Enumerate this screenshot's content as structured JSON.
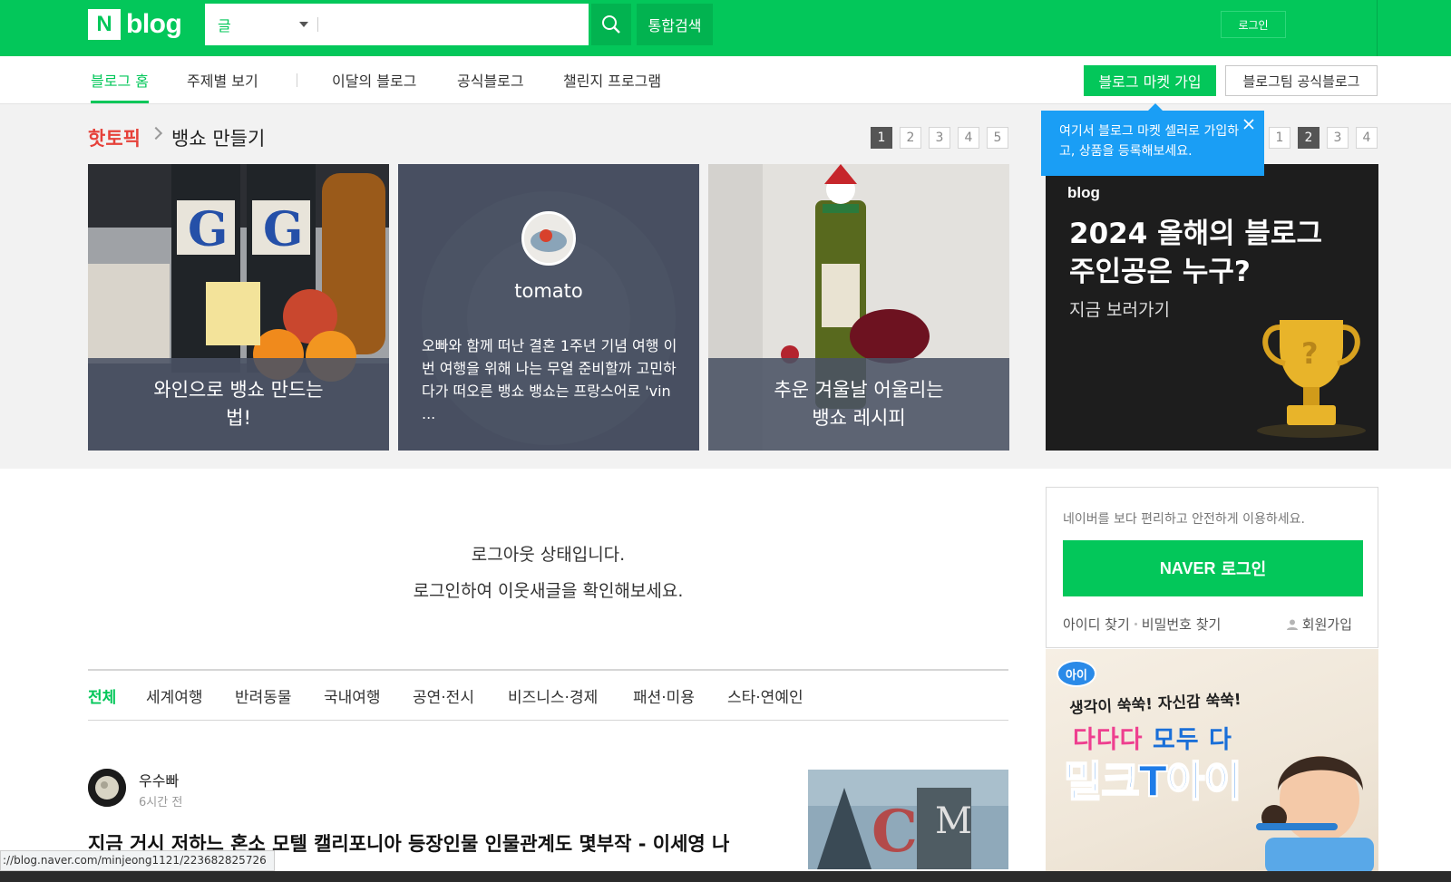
{
  "header": {
    "logo_n": "N",
    "logo_blog": "blog",
    "search_scope": "글",
    "search_placeholder": "",
    "unified_search": "통합검색",
    "login": "로그인"
  },
  "subnav": {
    "items": [
      "블로그 홈",
      "주제별 보기",
      "이달의 블로그",
      "공식블로그",
      "챌린지 프로그램"
    ],
    "market_join": "블로그 마켓 가입",
    "official_team": "블로그팀 공식블로그"
  },
  "hot": {
    "label": "핫토픽",
    "topic": "뱅쇼 만들기",
    "pages": [
      "1",
      "2",
      "3",
      "4",
      "5"
    ],
    "active_page": "1",
    "cards": [
      {
        "caption": "와인으로 뱅쇼 만드는 법!"
      },
      {
        "author": "tomato",
        "excerpt": "오빠와 함께 떠난 결혼 1주년 기념 여행 이번 여행을 위해 나는 무얼 준비할까 고민하다가 떠오른 뱅쇼 뱅쇼는 프랑스어로 'vin ..."
      },
      {
        "caption": "추운 겨울날 어울리는 뱅쇼 레시피"
      }
    ]
  },
  "promo": {
    "pages": [
      "1",
      "2",
      "3",
      "4"
    ],
    "active_page": "2",
    "logo": "blog",
    "title": "2024 올해의 블로그 주인공은 누구?",
    "sub": "지금 보러가기",
    "tooltip": "여기서 블로그 마켓 셀러로 가입하고, 상품을 등록해보세요."
  },
  "main": {
    "logout_line1": "로그아웃 상태입니다.",
    "logout_line2": "로그인하여 이웃새글을 확인해보세요.",
    "categories": [
      "전체",
      "세계여행",
      "반려동물",
      "국내여행",
      "공연·전시",
      "비즈니스·경제",
      "패션·미용",
      "스타·연예인"
    ],
    "post": {
      "author": "우수빠",
      "time": "6시간 전",
      "title": "지금 거시 저하느 혼소 모텔 캘리포니아 등장인물 인물관계도 몇부작 - 이세영 나"
    }
  },
  "login_box": {
    "desc": "네이버를 보다 편리하고 안전하게 이용하세요.",
    "button_brand": "NAVER",
    "button_label": "로그인",
    "find_id": "아이디 찾기",
    "find_pw": "비밀번호 찾기",
    "signup": "회원가입"
  },
  "ad": {
    "badge": "아이",
    "line1": "생각이 쑥쑥! 자신감 쑥쑥!",
    "line2a": "다다다",
    "line2b": "모두 다",
    "line3": "밀크T아이"
  },
  "status": {
    "url": "://blog.naver.com/minjeong1121/223682825726"
  },
  "colors": {
    "brand": "#03c75a",
    "hot": "#e6413a",
    "tooltip": "#1a9ef5"
  }
}
